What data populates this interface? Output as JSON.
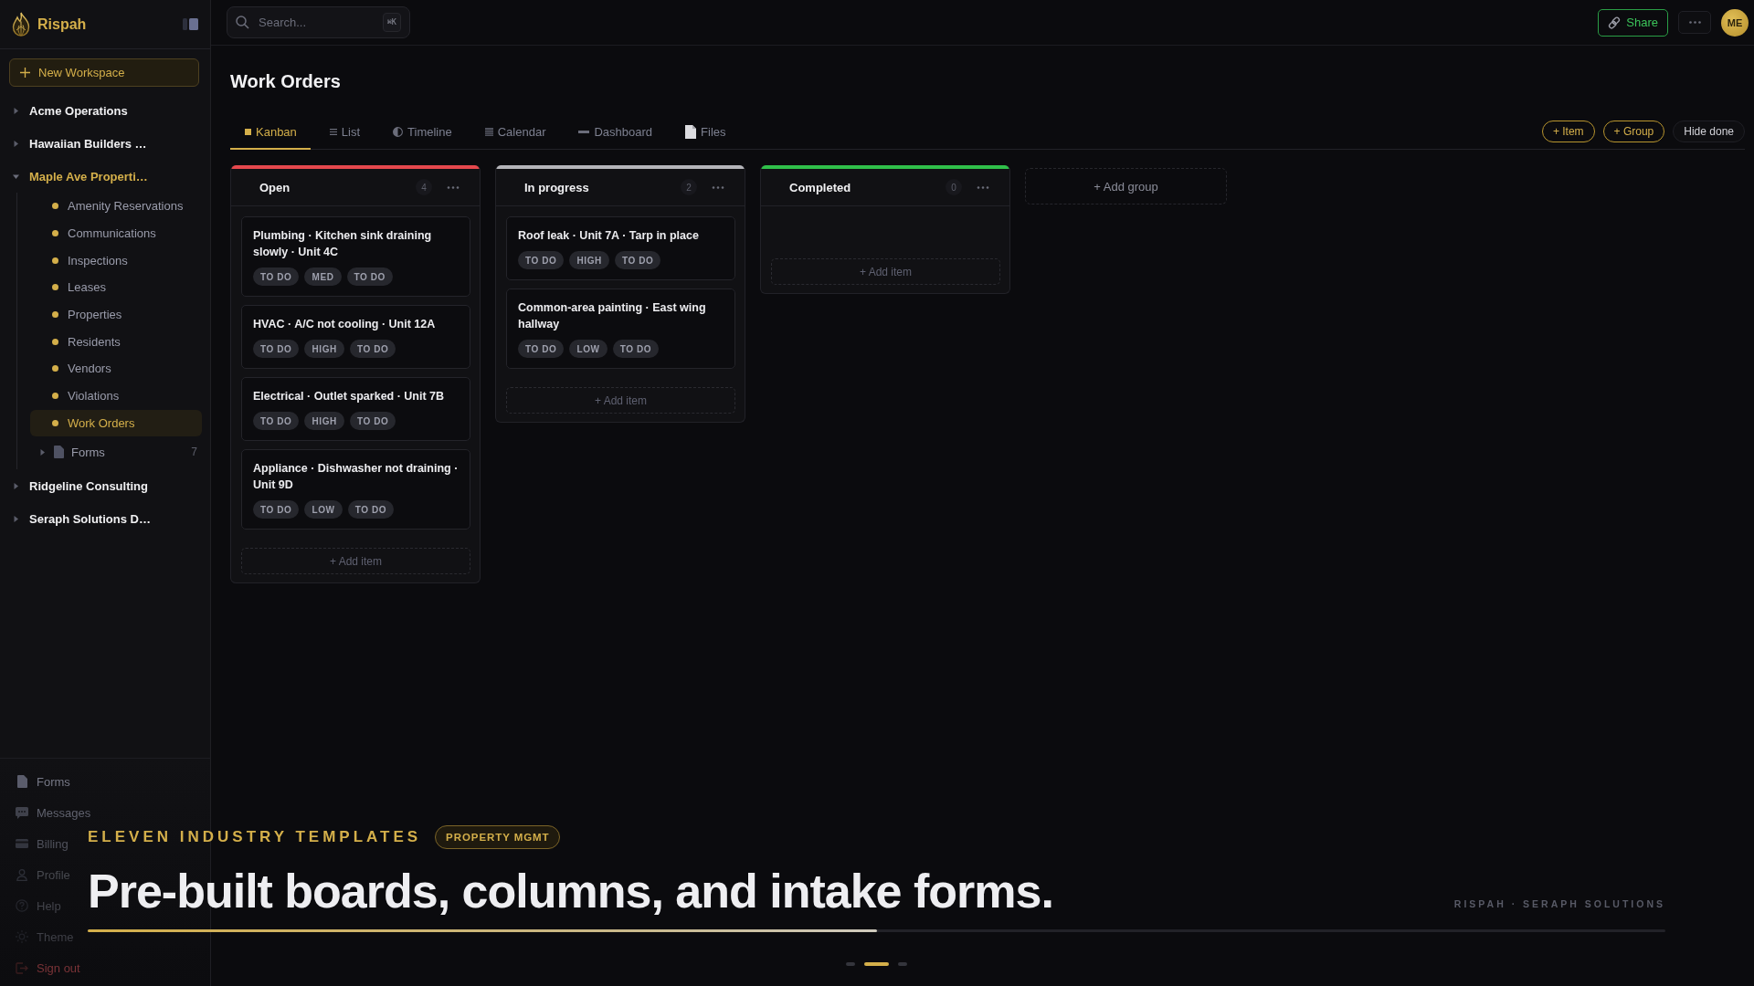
{
  "app": {
    "name": "Rispah",
    "new_workspace": "New Workspace"
  },
  "sidebar": {
    "workspaces": [
      {
        "name": "Acme Operations",
        "expanded": false
      },
      {
        "name": "Hawaiian Builders …",
        "expanded": false
      },
      {
        "name": "Maple Ave Properti…",
        "expanded": true,
        "boards": [
          {
            "name": "Amenity Reservations",
            "selected": false
          },
          {
            "name": "Communications",
            "selected": false
          },
          {
            "name": "Inspections",
            "selected": false
          },
          {
            "name": "Leases",
            "selected": false
          },
          {
            "name": "Properties",
            "selected": false
          },
          {
            "name": "Residents",
            "selected": false
          },
          {
            "name": "Vendors",
            "selected": false
          },
          {
            "name": "Violations",
            "selected": false
          },
          {
            "name": "Work Orders",
            "selected": true
          }
        ],
        "folders": [
          {
            "name": "Forms",
            "count": "7",
            "expanded": false
          }
        ]
      },
      {
        "name": "Ridgeline Consulting",
        "expanded": false
      },
      {
        "name": "Seraph Solutions D…",
        "expanded": false
      }
    ],
    "footer": [
      {
        "label": "Forms",
        "kind": "nav"
      },
      {
        "label": "Messages",
        "kind": "nav"
      },
      {
        "label": "Billing",
        "kind": "nav"
      },
      {
        "label": "Profile",
        "kind": "nav"
      },
      {
        "label": "Help",
        "kind": "nav"
      },
      {
        "label": "Theme",
        "kind": "nav"
      },
      {
        "label": "Sign out",
        "kind": "danger"
      }
    ]
  },
  "topbar": {
    "search": {
      "placeholder": "Search...",
      "shortcut": "⌘K"
    },
    "share": "Share",
    "avatar": "ME"
  },
  "page": {
    "title": "Work Orders",
    "view_tabs": [
      {
        "label": "Kanban",
        "selected": true
      },
      {
        "label": "List",
        "selected": false
      },
      {
        "label": "Timeline",
        "selected": false
      },
      {
        "label": "Calendar",
        "selected": false
      },
      {
        "label": "Dashboard",
        "selected": false
      },
      {
        "label": "Files",
        "selected": false
      }
    ],
    "actions": [
      {
        "label": "+ Item",
        "kind": "accent"
      },
      {
        "label": "+ Group",
        "kind": "accent"
      },
      {
        "label": "Hide done",
        "kind": "plain"
      }
    ]
  },
  "board": {
    "groups": [
      {
        "name": "Open",
        "color": "#e5484d",
        "count": "4",
        "cards": [
          {
            "title": "Plumbing · Kitchen sink draining slowly · Unit 4C",
            "tags": [
              "TO DO",
              "MED",
              "TO DO"
            ]
          },
          {
            "title": "HVAC · A/C not cooling · Unit 12A",
            "tags": [
              "TO DO",
              "HIGH",
              "TO DO"
            ]
          },
          {
            "title": "Electrical · Outlet sparked · Unit 7B",
            "tags": [
              "TO DO",
              "HIGH",
              "TO DO"
            ]
          },
          {
            "title": "Appliance · Dishwasher not draining · Unit 9D",
            "tags": [
              "TO DO",
              "LOW",
              "TO DO"
            ]
          }
        ],
        "add_item": "+ Add item"
      },
      {
        "name": "In progress",
        "color": "#b4b4b9",
        "count": "2",
        "cards": [
          {
            "title": "Roof leak · Unit 7A · Tarp in place",
            "tags": [
              "TO DO",
              "HIGH",
              "TO DO"
            ]
          },
          {
            "title": "Common-area painting · East wing hallway",
            "tags": [
              "TO DO",
              "LOW",
              "TO DO"
            ]
          }
        ],
        "add_item": "+ Add item"
      },
      {
        "name": "Completed",
        "color": "#30c04a",
        "count": "0",
        "add_item": "+ Add item"
      }
    ],
    "add_group": "+ Add group"
  },
  "caption": {
    "eyebrow": "ELEVEN INDUSTRY TEMPLATES",
    "badge": "PROPERTY MGMT",
    "headline": "Pre-built boards, columns, and intake forms.",
    "credit": "RISPAH · SERAPH SOLUTIONS",
    "progress": {
      "level": 0.5
    },
    "slides": [
      {
        "selected": false
      },
      {
        "selected": true
      },
      {
        "selected": false
      }
    ]
  }
}
